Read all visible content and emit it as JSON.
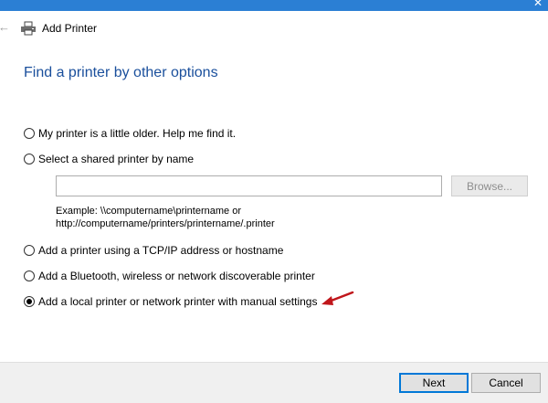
{
  "window": {
    "close_glyph": "✕"
  },
  "header": {
    "title": "Add Printer",
    "back_icon": "back-arrow-icon",
    "app_icon": "printer-icon"
  },
  "page": {
    "title": "Find a printer by other options"
  },
  "options": [
    {
      "label": "My printer is a little older. Help me find it.",
      "checked": false
    },
    {
      "label": "Select a shared printer by name",
      "checked": false
    },
    {
      "label": "Add a printer using a TCP/IP address or hostname",
      "checked": false
    },
    {
      "label": "Add a Bluetooth, wireless or network discoverable printer",
      "checked": false
    },
    {
      "label": "Add a local printer or network printer with manual settings",
      "checked": true
    }
  ],
  "shared_printer": {
    "input_value": "",
    "browse_label": "Browse...",
    "example_line1": "Example: \\\\computername\\printername or",
    "example_line2": "http://computername/printers/printername/.printer"
  },
  "footer": {
    "next_label": "Next",
    "cancel_label": "Cancel"
  },
  "colors": {
    "title_blue": "#1a4f9c",
    "accent": "#0078d7",
    "annotation_arrow": "#c0161b"
  }
}
